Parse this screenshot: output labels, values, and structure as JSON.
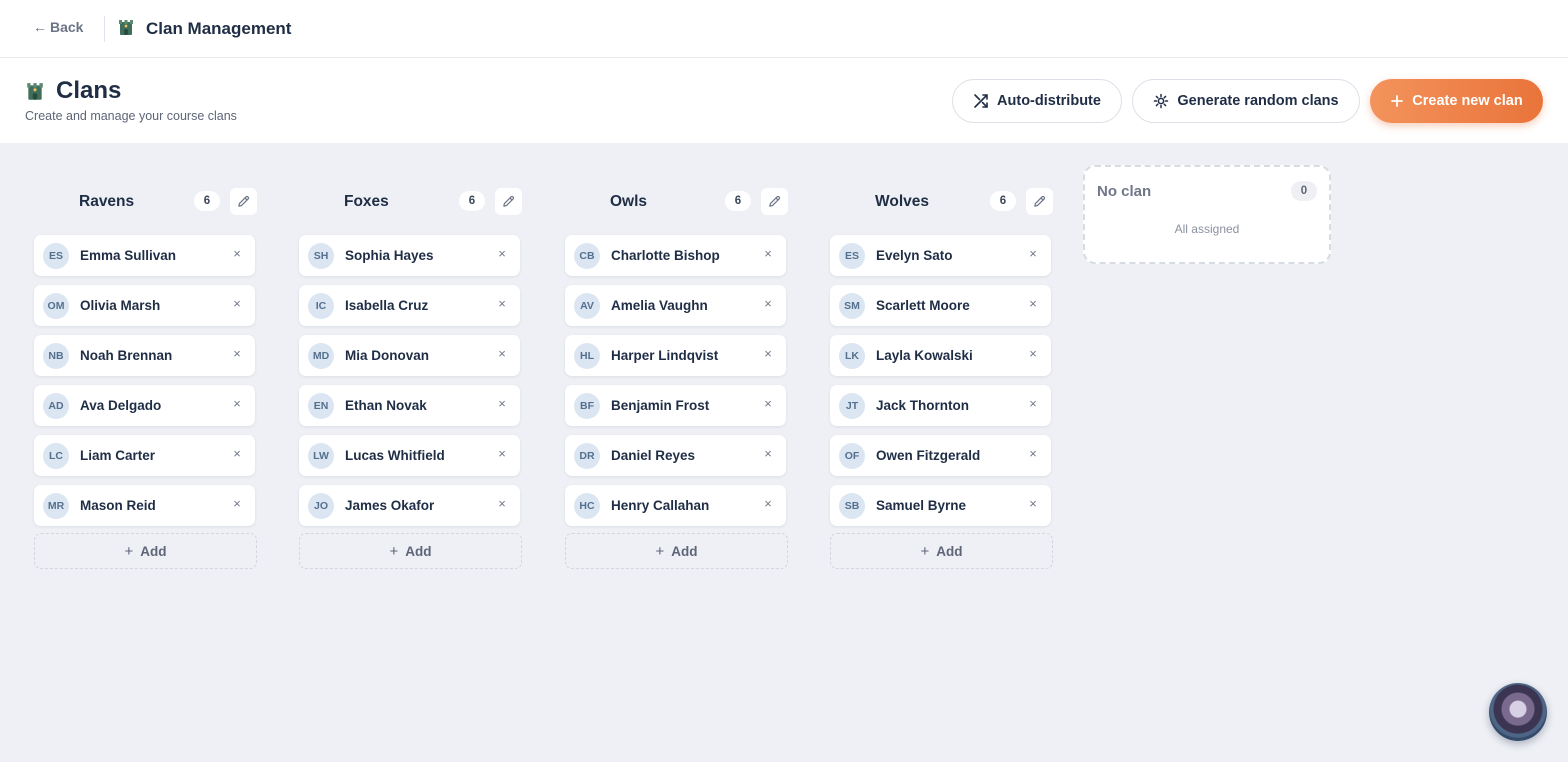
{
  "topbar": {
    "back_label": "Back",
    "back_icon": "arrow-left-icon",
    "app_icon": "castle-icon",
    "title": "Clan Management"
  },
  "header": {
    "icon": "castle-icon",
    "title": "Clans",
    "subtitle": "Create and manage your course clans",
    "auto_distribute_label": "Auto-distribute",
    "generate_label": "Generate random clans",
    "create_label": "Create new clan",
    "accent_color": "#ee8046"
  },
  "add_label": "Add",
  "clans": [
    {
      "name": "Ravens",
      "count": "6",
      "members": [
        {
          "initials": "ES",
          "name": "Emma Sullivan"
        },
        {
          "initials": "OM",
          "name": "Olivia Marsh"
        },
        {
          "initials": "NB",
          "name": "Noah Brennan"
        },
        {
          "initials": "AD",
          "name": "Ava Delgado"
        },
        {
          "initials": "LC",
          "name": "Liam Carter"
        },
        {
          "initials": "MR",
          "name": "Mason Reid"
        }
      ]
    },
    {
      "name": "Foxes",
      "count": "6",
      "members": [
        {
          "initials": "SH",
          "name": "Sophia Hayes"
        },
        {
          "initials": "IC",
          "name": "Isabella Cruz"
        },
        {
          "initials": "MD",
          "name": "Mia Donovan"
        },
        {
          "initials": "EN",
          "name": "Ethan Novak"
        },
        {
          "initials": "LW",
          "name": "Lucas Whitfield"
        },
        {
          "initials": "JO",
          "name": "James Okafor"
        }
      ]
    },
    {
      "name": "Owls",
      "count": "6",
      "members": [
        {
          "initials": "CB",
          "name": "Charlotte Bishop"
        },
        {
          "initials": "AV",
          "name": "Amelia Vaughn"
        },
        {
          "initials": "HL",
          "name": "Harper Lindqvist"
        },
        {
          "initials": "BF",
          "name": "Benjamin Frost"
        },
        {
          "initials": "DR",
          "name": "Daniel Reyes"
        },
        {
          "initials": "HC",
          "name": "Henry Callahan"
        }
      ]
    },
    {
      "name": "Wolves",
      "count": "6",
      "members": [
        {
          "initials": "ES",
          "name": "Evelyn Sato"
        },
        {
          "initials": "SM",
          "name": "Scarlett Moore"
        },
        {
          "initials": "LK",
          "name": "Layla Kowalski"
        },
        {
          "initials": "JT",
          "name": "Jack Thornton"
        },
        {
          "initials": "OF",
          "name": "Owen Fitzgerald"
        },
        {
          "initials": "SB",
          "name": "Samuel Byrne"
        }
      ]
    }
  ],
  "no_clan": {
    "title": "No clan",
    "count": "0",
    "status": "All assigned"
  },
  "assistant": {
    "icon": "assistant-avatar-icon"
  }
}
